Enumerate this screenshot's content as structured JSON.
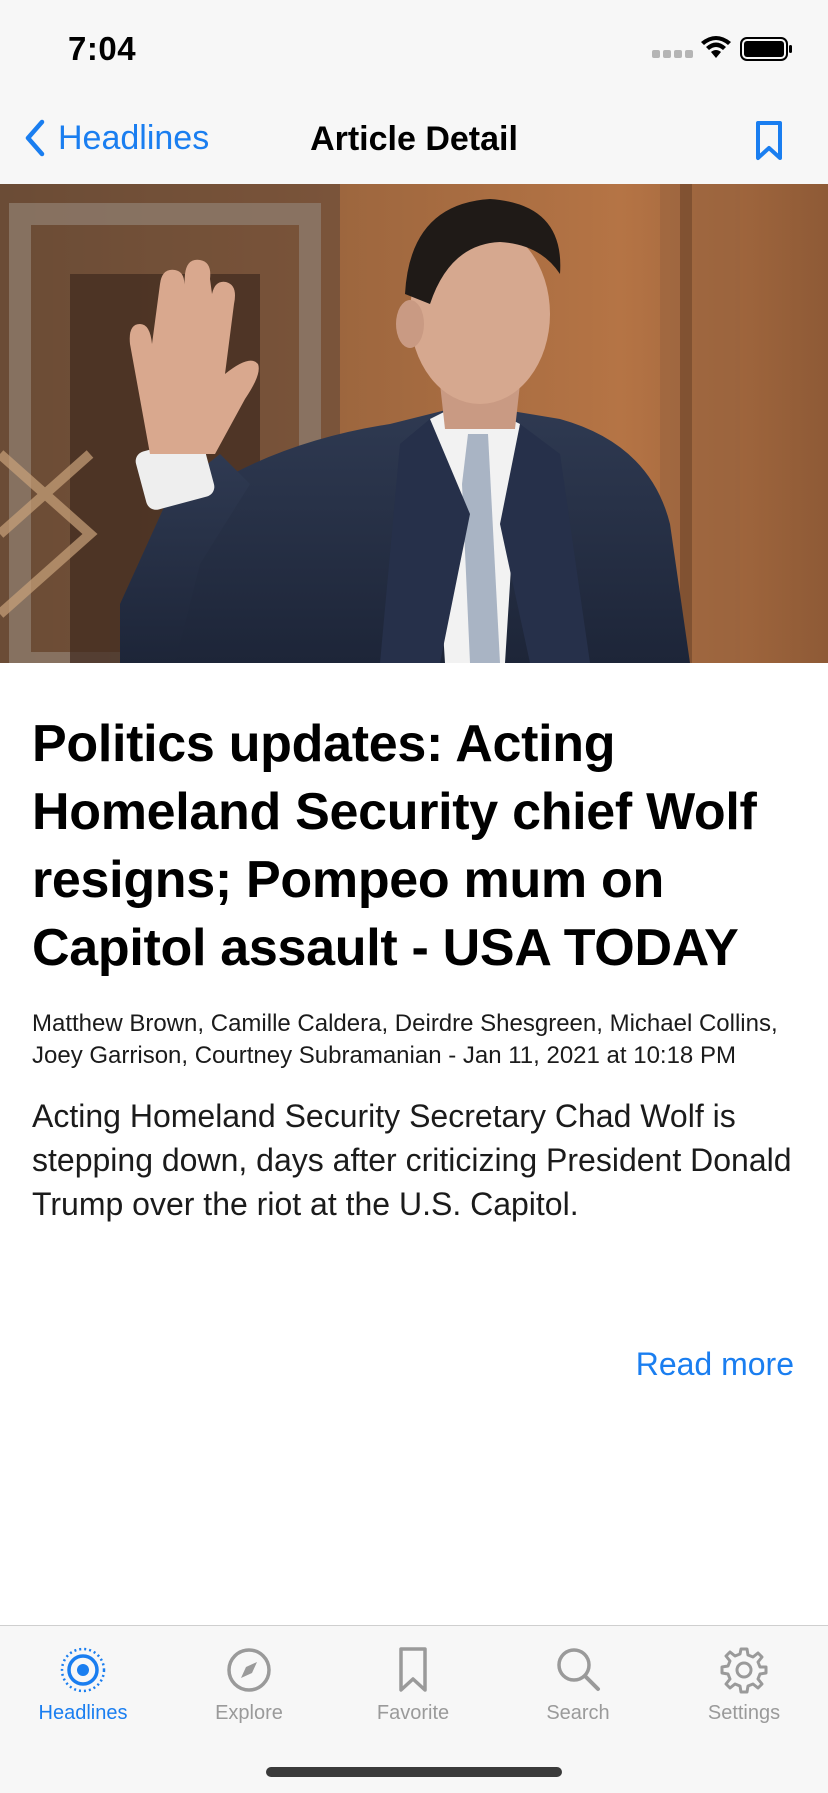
{
  "status_bar": {
    "time": "7:04"
  },
  "nav": {
    "back_label": "Headlines",
    "title": "Article Detail"
  },
  "article": {
    "headline": "Politics updates: Acting Homeland Security chief Wolf resigns; Pompeo mum on Capitol assault - USA TODAY",
    "byline": "Matthew Brown, Camille Caldera, Deirdre Shesgreen, Michael Collins, Joey Garrison, Courtney Subramanian - Jan 11, 2021 at 10:18 PM",
    "summary": "Acting Homeland Security Secretary Chad Wolf is stepping down, days after criticizing President Donald Trump over the riot at the U.S. Capitol.",
    "read_more": "Read more"
  },
  "tabs": [
    {
      "label": "Headlines",
      "icon": "headlines-icon",
      "active": true
    },
    {
      "label": "Explore",
      "icon": "compass-icon",
      "active": false
    },
    {
      "label": "Favorite",
      "icon": "bookmark-icon",
      "active": false
    },
    {
      "label": "Search",
      "icon": "search-icon",
      "active": false
    },
    {
      "label": "Settings",
      "icon": "gear-icon",
      "active": false
    }
  ],
  "colors": {
    "accent": "#1a7ef0",
    "bar_background": "#f7f7f7",
    "inactive_tab": "#9a9a9a"
  }
}
